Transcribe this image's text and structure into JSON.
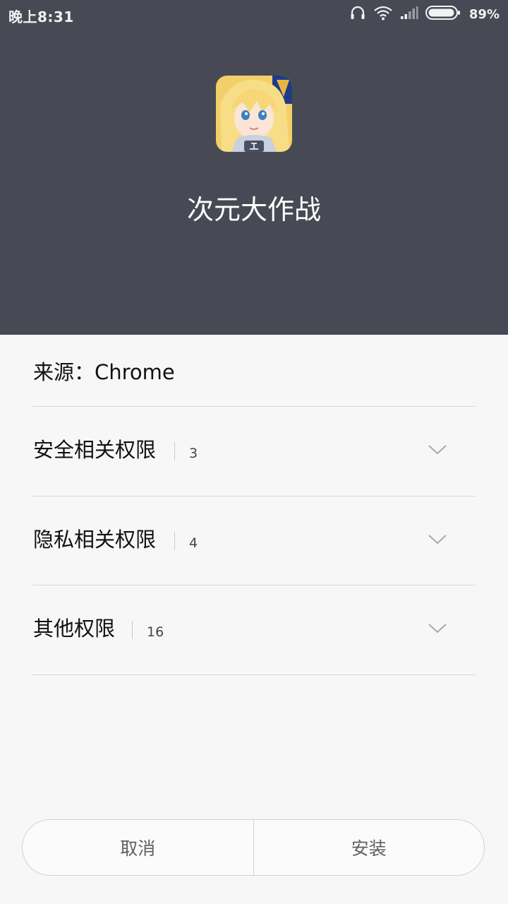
{
  "status_bar": {
    "time": "晚上8:31",
    "battery": "89%",
    "icons": [
      "headphones-icon",
      "wifi-icon",
      "signal-icon",
      "battery-icon"
    ]
  },
  "app": {
    "name": "次元大作战",
    "icon": "app-anime-girl-icon"
  },
  "source": {
    "text": "来源：Chrome"
  },
  "permissions": [
    {
      "label": "安全相关权限",
      "count": "3"
    },
    {
      "label": "隐私相关权限",
      "count": "4"
    },
    {
      "label": "其他权限",
      "count": "16"
    }
  ],
  "buttons": {
    "cancel": "取消",
    "install": "安装"
  },
  "colors": {
    "header_bg": "#474a54",
    "content_bg": "#f7f7f7"
  }
}
